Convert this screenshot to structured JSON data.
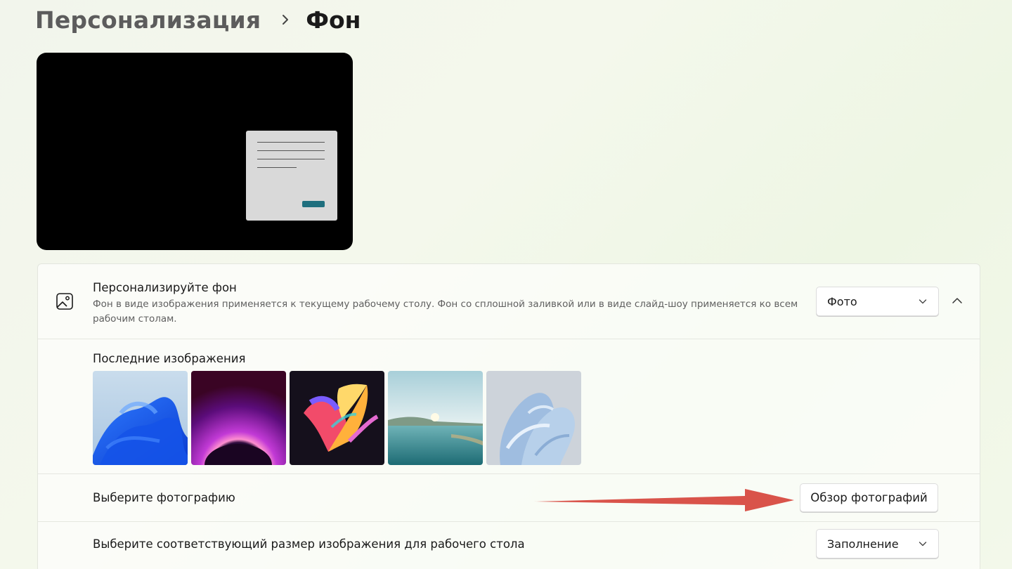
{
  "breadcrumb": {
    "parent": "Персонализация",
    "separator_icon": "chevron-right-icon",
    "current": "Фон"
  },
  "preview": {
    "background_color": "#000000",
    "accent_button_color": "#1f6f7e"
  },
  "background_setting": {
    "icon": "image-icon",
    "title": "Персонализируйте фон",
    "description": "Фон в виде изображения применяется к текущему рабочему столу. Фон со сплошной заливкой или в виде слайд-шоу применяется ко всем рабочим столам.",
    "type_dropdown": {
      "value": "Фото",
      "icon": "chevron-down-icon"
    },
    "collapse_icon": "chevron-up-icon"
  },
  "recent_images": {
    "label": "Последние изображения",
    "items": [
      {
        "name": "blue-bloom"
      },
      {
        "name": "purple-glow"
      },
      {
        "name": "colorful-ribbon"
      },
      {
        "name": "lake-sunrise"
      },
      {
        "name": "light-blue-bloom"
      }
    ]
  },
  "choose_photo": {
    "label": "Выберите фотографию",
    "button": "Обзор фотографий",
    "annotation_arrow_color": "#d9534a"
  },
  "fit": {
    "label": "Выберите соответствующий размер изображения для рабочего стола",
    "dropdown": {
      "value": "Заполнение",
      "icon": "chevron-down-icon"
    }
  }
}
